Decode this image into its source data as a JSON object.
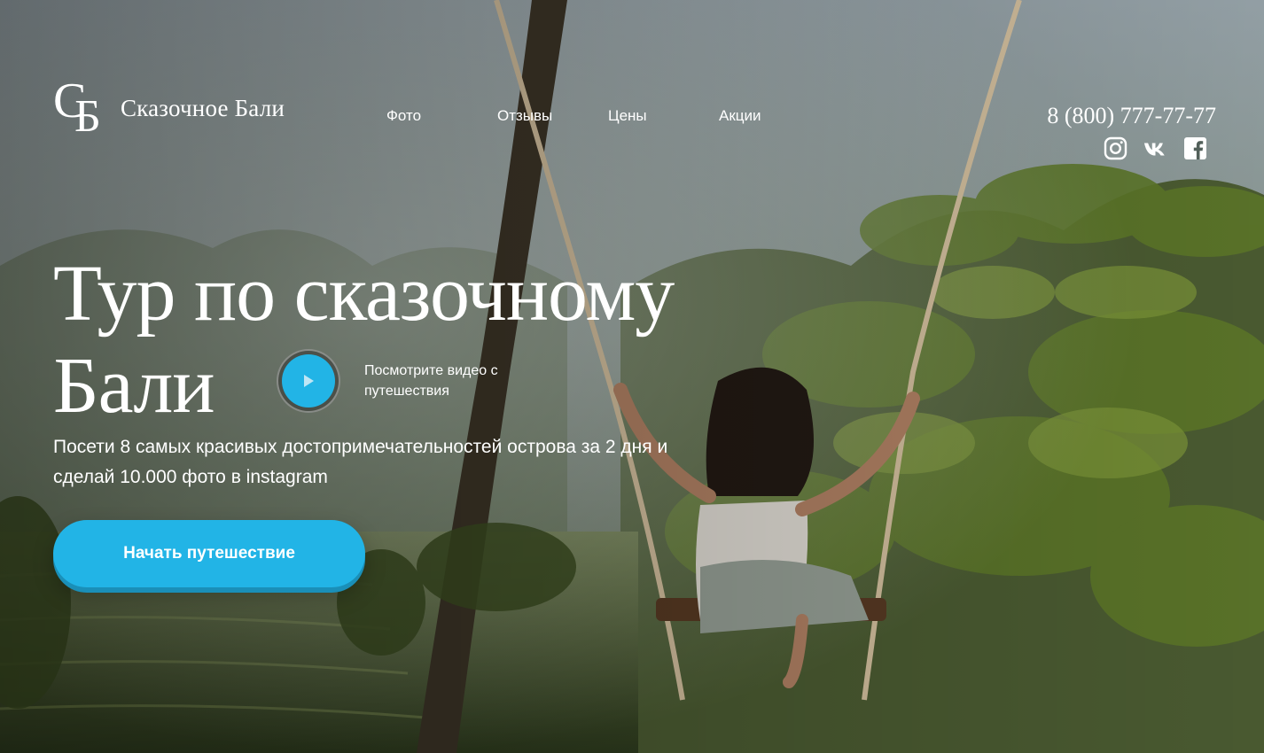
{
  "header": {
    "logo_mark_c": "С",
    "logo_mark_b": "Б",
    "logo_text": "Сказочное Бали",
    "nav": [
      {
        "label": "Фото"
      },
      {
        "label": "Отзывы"
      },
      {
        "label": "Цены"
      },
      {
        "label": "Акции"
      }
    ],
    "phone": "8 (800) 777-77-77",
    "socials": [
      {
        "icon": "instagram-icon"
      },
      {
        "icon": "vk-icon"
      },
      {
        "icon": "facebook-icon"
      }
    ]
  },
  "hero": {
    "title_line1": "Тур по сказочному",
    "title_line2": "Бали",
    "video_label": "Посмотрите видео с путешествия",
    "subtitle": "Посети 8 самых красивых достопримечательностей острова за 2 дня и сделай 10.000 фото в instagram",
    "cta_label": "Начать путешествие"
  },
  "colors": {
    "accent": "#22b4e6",
    "text": "#ffffff"
  }
}
